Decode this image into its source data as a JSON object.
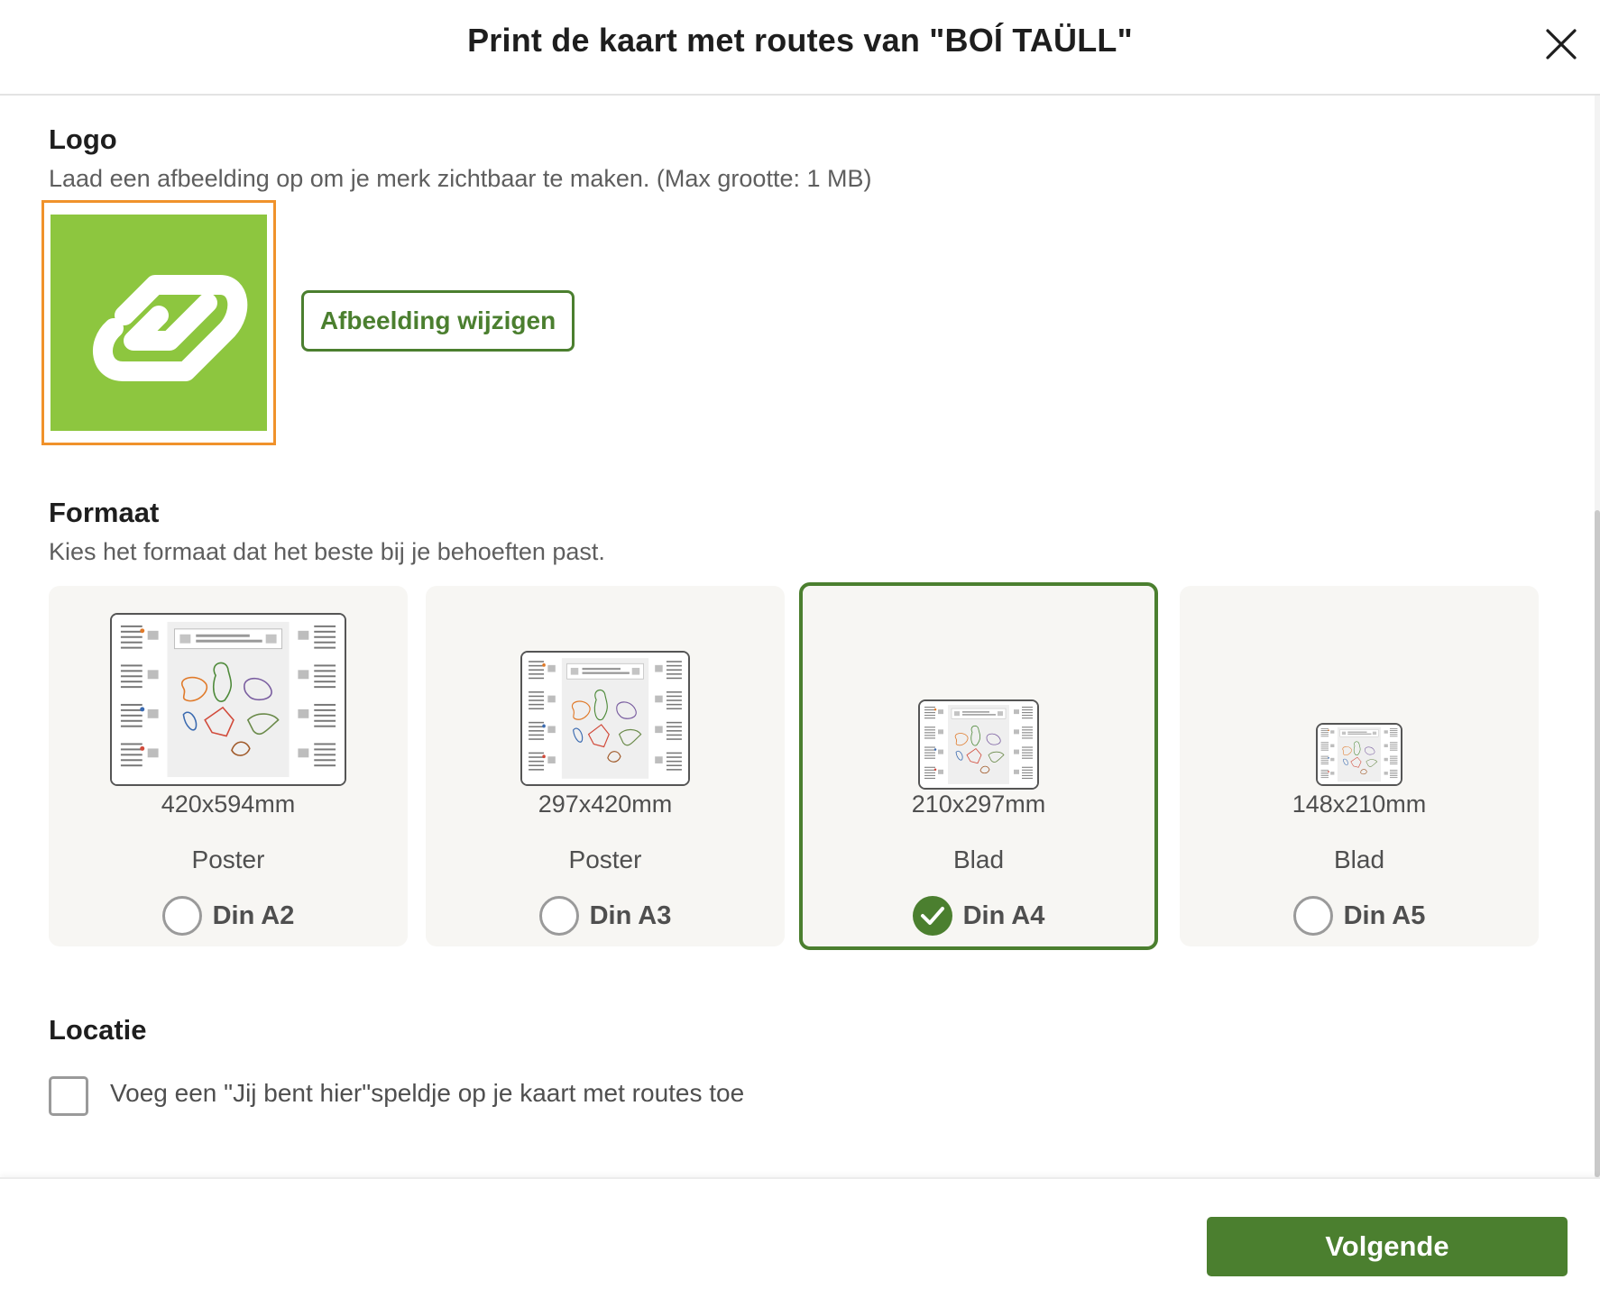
{
  "dialog": {
    "title": "Print de kaart met routes van \"BOÍ TAÜLL\""
  },
  "logo_section": {
    "title": "Logo",
    "description": "Laad een afbeelding op om je merk zichtbaar te maken. (Max grootte: 1 MB)",
    "change_button": "Afbeelding wijzigen"
  },
  "format_section": {
    "title": "Formaat",
    "description": "Kies het formaat dat het beste bij je behoeften past.",
    "options": [
      {
        "dims": "420x594mm",
        "kind": "Poster",
        "label": "Din A2",
        "selected": false
      },
      {
        "dims": "297x420mm",
        "kind": "Poster",
        "label": "Din A3",
        "selected": false
      },
      {
        "dims": "210x297mm",
        "kind": "Blad",
        "label": "Din A4",
        "selected": true
      },
      {
        "dims": "148x210mm",
        "kind": "Blad",
        "label": "Din A5",
        "selected": false
      }
    ]
  },
  "location_section": {
    "title": "Locatie",
    "checkbox_label": "Voeg een \"Jij bent hier\"speldje op je kaart met routes toe",
    "checked": false
  },
  "footer": {
    "next_button": "Volgende"
  },
  "colors": {
    "accent": "#4b7f2f",
    "logo_bg": "#8dc63f",
    "logo_border": "#f0922b",
    "card_bg": "#f7f6f3"
  },
  "icons": {
    "close": "close-icon",
    "logo": "link-logo-icon",
    "check": "check-icon"
  }
}
